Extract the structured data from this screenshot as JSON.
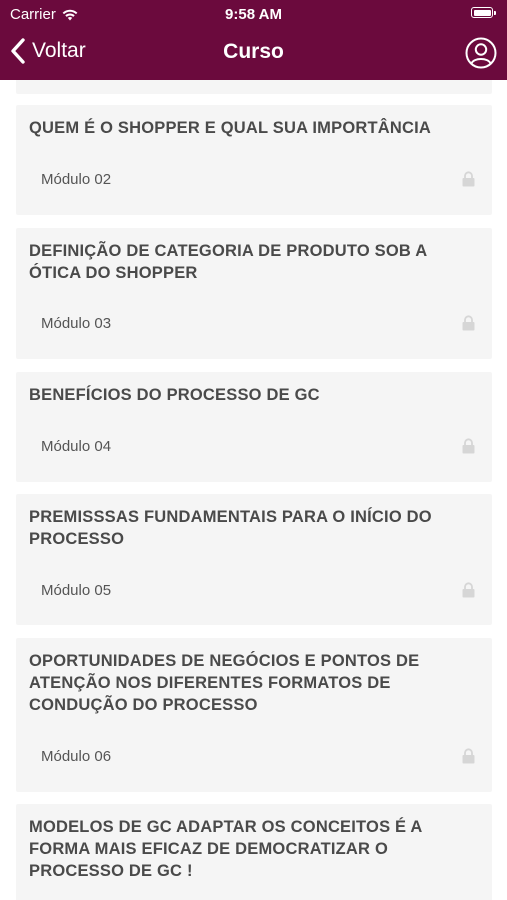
{
  "status_bar": {
    "carrier": "Carrier",
    "time": "9:58 AM"
  },
  "nav": {
    "back_label": "Voltar",
    "title": "Curso"
  },
  "modules": [
    {
      "title": "QUEM É O SHOPPER E QUAL SUA IMPORTÂNCIA",
      "label": "Módulo 02",
      "locked": true
    },
    {
      "title": "DEFINIÇÃO DE CATEGORIA DE PRODUTO SOB A ÓTICA DO SHOPPER",
      "label": "Módulo 03",
      "locked": true
    },
    {
      "title": "BENEFÍCIOS DO PROCESSO DE GC",
      "label": "Módulo 04",
      "locked": true
    },
    {
      "title": "PREMISSSAS FUNDAMENTAIS PARA O INÍCIO DO PROCESSO",
      "label": "Módulo 05",
      "locked": true
    },
    {
      "title": "OPORTUNIDADES DE NEGÓCIOS E PONTOS DE ATENÇÃO NOS DIFERENTES FORMATOS DE CONDUÇÃO DO PROCESSO",
      "label": "Módulo 06",
      "locked": true
    },
    {
      "title": "MODELOS DE GC ADAPTAR OS CONCEITOS É A FORMA MAIS EFICAZ DE DEMOCRATIZAR O PROCESSO DE GC !"
    }
  ],
  "colors": {
    "accent": "#6b0a3d",
    "card_bg": "#f5f5f5",
    "lock": "#d6d6d6"
  },
  "icons": {
    "back": "chevron-left-icon",
    "profile": "user-circle-icon",
    "lock": "lock-icon",
    "wifi": "wifi-icon",
    "battery": "battery-icon"
  }
}
